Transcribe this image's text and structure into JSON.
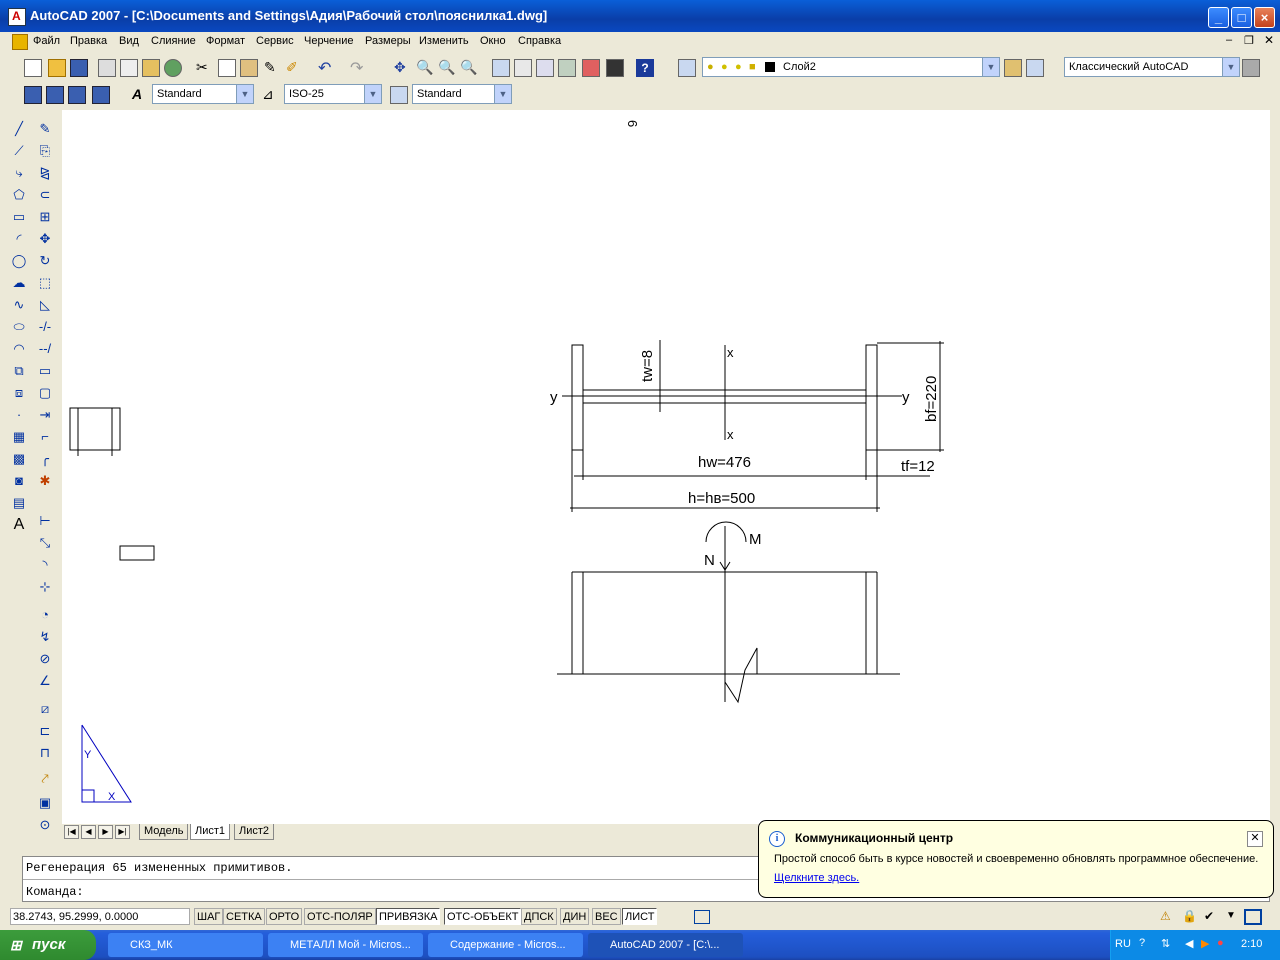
{
  "window": {
    "title": "AutoCAD 2007 - [C:\\Documents and Settings\\Адия\\Рабочий стол\\пояснилка1.dwg]"
  },
  "menu": [
    "Файл",
    "Правка",
    "Вид",
    "Слияние",
    "Формат",
    "Сервис",
    "Черчение",
    "Размеры",
    "Изменить",
    "Окно",
    "Справка"
  ],
  "toolbar": {
    "layer_value": "Слой2",
    "workspace_value": "Классический AutoCAD",
    "text_style": "Standard",
    "dim_style": "ISO-25",
    "table_style": "Standard"
  },
  "drawing": {
    "labels": {
      "tw": "tw=8",
      "bf": "bf=220",
      "tf": "tf=12",
      "hw": "hw=476",
      "h": "h=hв=500",
      "x_top": "x",
      "x_bottom": "x",
      "y_left": "y",
      "y_right": "y",
      "n": "N",
      "m": "M",
      "top_glyph": "6",
      "ucs_y": "Y",
      "ucs_x": "X"
    }
  },
  "layout_tabs": [
    "Модель",
    "Лист1",
    "Лист2"
  ],
  "command": {
    "line1": "Регенерация 65 измененных примитивов.",
    "prompt": "Команда:"
  },
  "status": {
    "coords": "38.2743, 95.2999, 0.0000",
    "toggles": [
      {
        "label": "ШАГ",
        "on": false
      },
      {
        "label": "СЕТКА",
        "on": false
      },
      {
        "label": "ОРТО",
        "on": false
      },
      {
        "label": "ОТС-ПОЛЯР",
        "on": false
      },
      {
        "label": "ПРИВЯЗКА",
        "on": true
      },
      {
        "label": "ОТС-ОБЪЕКТ",
        "on": true
      },
      {
        "label": "ДПСК",
        "on": false
      },
      {
        "label": "ДИН",
        "on": false
      },
      {
        "label": "ВЕС",
        "on": false
      },
      {
        "label": "ЛИСТ",
        "on": true
      }
    ]
  },
  "balloon": {
    "title": "Коммуникационный центр",
    "text": "Простой способ быть в курсе новостей и своевременно обновлять программное обеспечение.",
    "link": "Щелкните здесь."
  },
  "taskbar": {
    "start": "пуск",
    "tasks": [
      "СКЗ_МК",
      "МЕТАЛЛ Мой - Micros...",
      "Содержание - Micros...",
      "AutoCAD 2007 - [C:\\..."
    ],
    "lang": "RU",
    "clock": "2:10"
  }
}
